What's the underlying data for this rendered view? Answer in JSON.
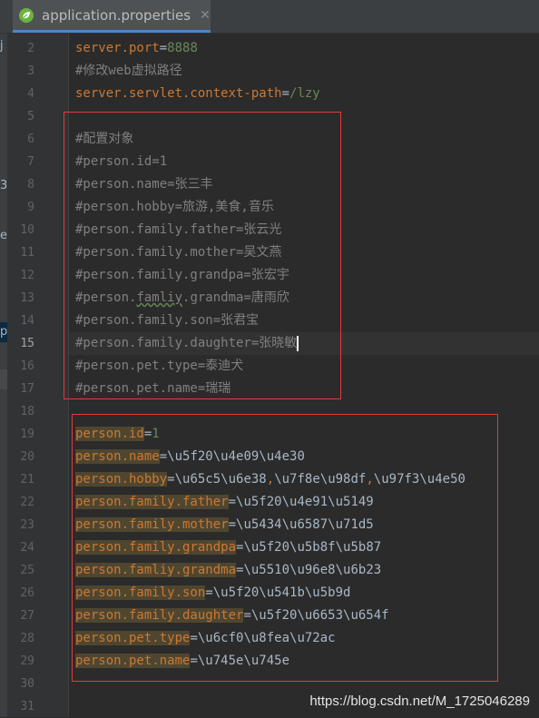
{
  "tab": {
    "title": "application.properties",
    "close": "✕",
    "icon": "spring-leaf-icon"
  },
  "left_strip": [
    "j",
    "3",
    "e",
    "p"
  ],
  "line_numbers": [
    "2",
    "3",
    "4",
    "5",
    "6",
    "7",
    "8",
    "9",
    "10",
    "11",
    "12",
    "13",
    "14",
    "15",
    "16",
    "17",
    "18",
    "19",
    "20",
    "21",
    "22",
    "23",
    "24",
    "25",
    "26",
    "27",
    "28",
    "29",
    "30",
    "31"
  ],
  "active_line": "15",
  "code": {
    "l2": {
      "key": "server.port",
      "eq": "=",
      "value": "8888"
    },
    "l3": {
      "comment": "#修改web虚拟路径"
    },
    "l4": {
      "key": "server.servlet.context-path",
      "eq": "=",
      "value": "/lzy"
    },
    "l6": {
      "comment": "#配置对象"
    },
    "l7": {
      "comment": "#person.id=1"
    },
    "l8": {
      "comment": "#person.name=张三丰"
    },
    "l9": {
      "comment": "#person.hobby=旅游,美食,音乐"
    },
    "l10": {
      "comment": "#person.family.father=张云光"
    },
    "l11": {
      "comment": "#person.family.mother=吴文燕"
    },
    "l12": {
      "comment": "#person.family.grandpa=张宏宇"
    },
    "l13": {
      "comment_a": "#person.",
      "comment_typo": "famliy",
      "comment_b": ".grandma=唐雨欣"
    },
    "l14": {
      "comment": "#person.family.son=张君宝"
    },
    "l15": {
      "comment": "#person.family.daughter=张晓敏"
    },
    "l16": {
      "comment": "#person.pet.type=泰迪犬"
    },
    "l17": {
      "comment": "#person.pet.name=瑞瑞"
    },
    "l19": {
      "key": "person.id",
      "eq": "=",
      "value": "1"
    },
    "l20": {
      "key": "person.name",
      "eq": "=",
      "value": "\\u5f20\\u4e09\\u4e30"
    },
    "l21": {
      "key": "person.hobby",
      "eq": "=",
      "v1": "\\u65c5\\u6e38",
      "sep1": ",",
      "v2": "\\u7f8e\\u98df",
      "sep2": ",",
      "v3": "\\u97f3\\u4e50"
    },
    "l22": {
      "key": "person.family.father",
      "eq": "=",
      "value": "\\u5f20\\u4e91\\u5149"
    },
    "l23": {
      "key": "person.family.mother",
      "eq": "=",
      "value": "\\u5434\\u6587\\u71d5"
    },
    "l24": {
      "key": "person.family.grandpa",
      "eq": "=",
      "value": "\\u5f20\\u5b8f\\u5b87"
    },
    "l25": {
      "key": "person.famliy.grandma",
      "eq": "=",
      "value": "\\u5510\\u96e8\\u6b23"
    },
    "l26": {
      "key": "person.family.son",
      "eq": "=",
      "value": "\\u5f20\\u541b\\u5b9d"
    },
    "l27": {
      "key": "person.family.daughter",
      "eq": "=",
      "value": "\\u5f20\\u6653\\u654f"
    },
    "l28": {
      "key": "person.pet.type",
      "eq": "=",
      "value": "\\u6cf0\\u8fea\\u72ac"
    },
    "l29": {
      "key": "person.pet.name",
      "eq": "=",
      "value": "\\u745e\\u745e"
    }
  },
  "watermark": "https://blog.csdn.net/M_1725046289",
  "colors": {
    "key": "#cc7832",
    "value": "#6a8759",
    "comment": "#808080",
    "highlight": "#4f4630",
    "annotation_box": "#e03c3c"
  }
}
